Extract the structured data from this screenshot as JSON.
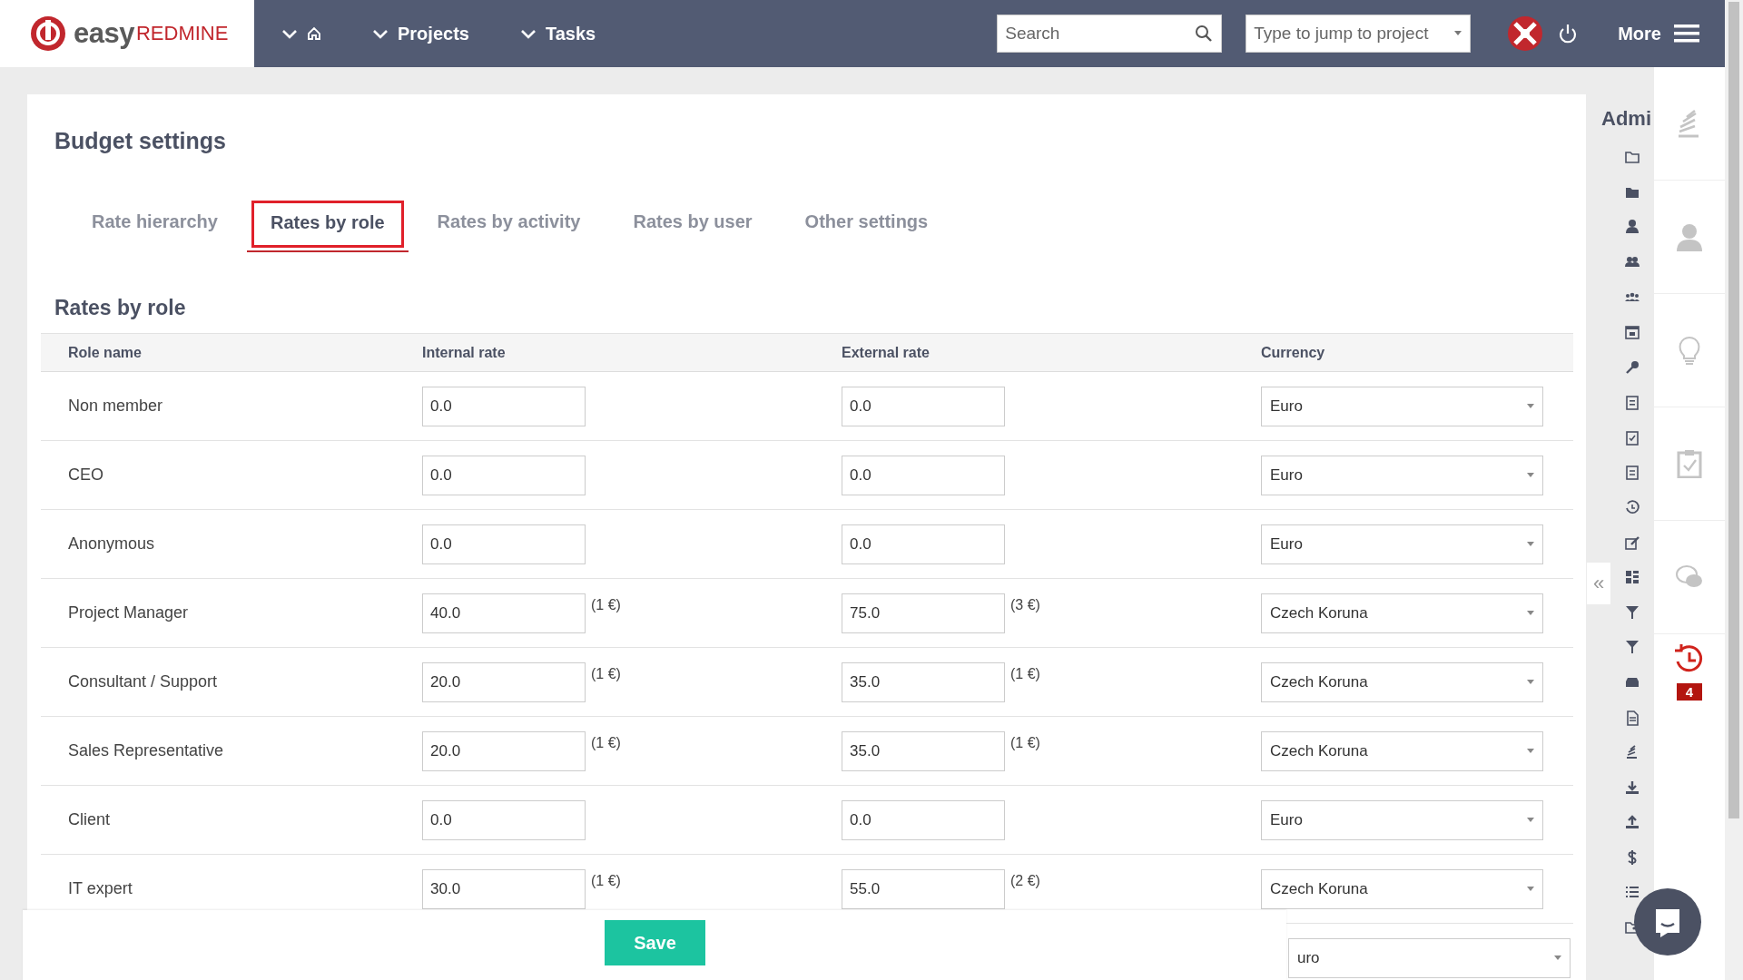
{
  "topbar": {
    "logo": {
      "word": "easy",
      "brand": "REDMINE"
    },
    "nav": [
      {
        "kind": "home"
      },
      {
        "kind": "menu",
        "label": "Projects"
      },
      {
        "kind": "menu",
        "label": "Tasks"
      }
    ],
    "search": {
      "placeholder": "Search"
    },
    "jump": {
      "placeholder": "Type to jump to project"
    },
    "more": "More"
  },
  "page": {
    "title": "Budget settings",
    "tabs": [
      {
        "label": "Rate hierarchy",
        "selected": false
      },
      {
        "label": "Rates by role",
        "selected": true
      },
      {
        "label": "Rates by activity",
        "selected": false
      },
      {
        "label": "Rates by user",
        "selected": false
      },
      {
        "label": "Other settings",
        "selected": false
      }
    ],
    "section": "Rates by role",
    "table": {
      "columns": [
        "Role name",
        "Internal rate",
        "External rate",
        "Currency"
      ],
      "rows": [
        {
          "role": "Non member",
          "internal": "0.0",
          "external": "0.0",
          "currency": "Euro"
        },
        {
          "role": "CEO",
          "internal": "0.0",
          "external": "0.0",
          "currency": "Euro"
        },
        {
          "role": "Anonymous",
          "internal": "0.0",
          "external": "0.0",
          "currency": "Euro"
        },
        {
          "role": "Project Manager",
          "internal": "40.0",
          "internal_note": "(1 €)",
          "external": "75.0",
          "external_note": "(3 €)",
          "currency": "Czech Koruna"
        },
        {
          "role": "Consultant / Support",
          "internal": "20.0",
          "internal_note": "(1 €)",
          "external": "35.0",
          "external_note": "(1 €)",
          "currency": "Czech Koruna"
        },
        {
          "role": "Sales Representative",
          "internal": "20.0",
          "internal_note": "(1 €)",
          "external": "35.0",
          "external_note": "(1 €)",
          "currency": "Czech Koruna"
        },
        {
          "role": "Client",
          "internal": "0.0",
          "external": "0.0",
          "currency": "Euro"
        },
        {
          "role": "IT expert",
          "internal": "30.0",
          "internal_note": "(1 €)",
          "external": "55.0",
          "external_note": "(2 €)",
          "currency": "Czech Koruna"
        },
        {
          "currency": "uro"
        }
      ]
    },
    "save": "Save"
  },
  "admin": {
    "title": "Admi",
    "collapse": "«"
  },
  "side_panel": {
    "badge": "4"
  }
}
